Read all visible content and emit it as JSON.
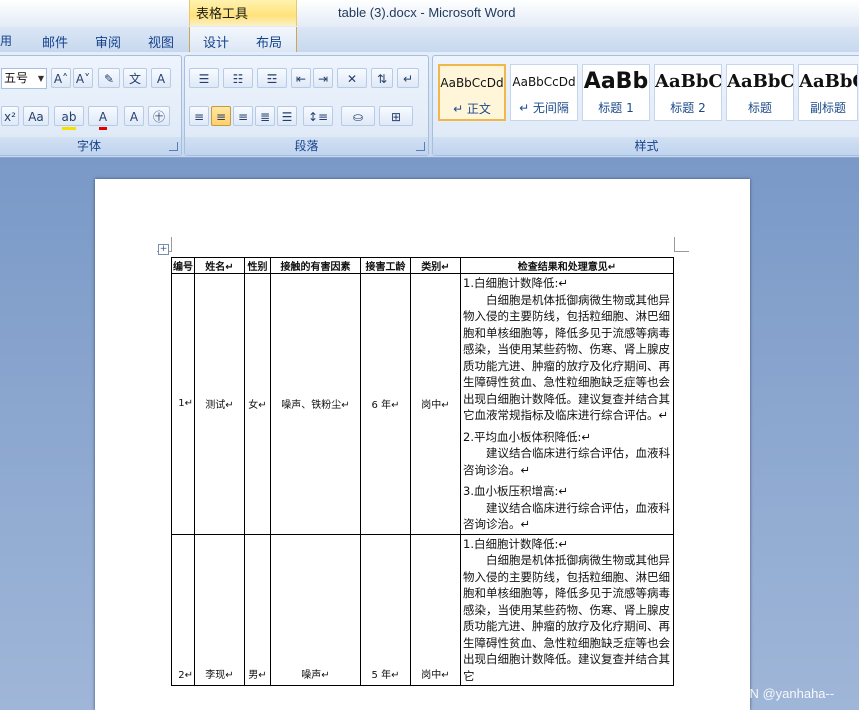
{
  "window": {
    "title": "table (3).docx - Microsoft Word",
    "context_tab": "表格工具"
  },
  "menu": {
    "tabs": [
      "用",
      "邮件",
      "审阅",
      "视图",
      "设计",
      "布局"
    ]
  },
  "ribbon": {
    "font_group": {
      "label": "字体",
      "font_size": "五号"
    },
    "paragraph_group": {
      "label": "段落"
    },
    "styles_group": {
      "label": "样式",
      "items": [
        {
          "sample": "AaBbCcDd",
          "name": "↵ 正文",
          "selected": true
        },
        {
          "sample": "AaBbCcDd",
          "name": "↵ 无间隔",
          "selected": false
        },
        {
          "sample": "AaBb",
          "name": "标题 1",
          "selected": false
        },
        {
          "sample": "AaBbC",
          "name": "标题 2",
          "selected": false
        },
        {
          "sample": "AaBbC",
          "name": "标题",
          "selected": false
        },
        {
          "sample": "AaBbC",
          "name": "副标题",
          "selected": false
        }
      ]
    }
  },
  "document": {
    "table": {
      "headers": [
        "编号",
        "姓名↵",
        "性别",
        "接触的有害因素",
        "接害工龄",
        "类别↵",
        "检查结果和处理意见↵"
      ],
      "rows": [
        {
          "id": "1↵",
          "name": "测试↵",
          "gender": "女↵",
          "hazard": "噪声、铁粉尘↵",
          "years": "6 年↵",
          "category": "岗中↵",
          "result": [
            {
              "title": "1.白细胞计数降低:↵",
              "body": "白细胞是机体抵御病微生物或其他异物入侵的主要防线，包括粒细胞、淋巴细胞和单核细胞等，降低多见于流感等病毒感染，当使用某些药物、伤寒、肾上腺皮质功能亢进、肿瘤的放疗及化疗期间、再生障碍性贫血、急性粒细胞缺乏症等也会出现白细胞计数降低。建议复查并结合其它血液常规指标及临床进行综合评估。↵"
            },
            {
              "title": "2.平均血小板体积降低:↵",
              "body": "建议结合临床进行综合评估，血液科咨询诊治。↵"
            },
            {
              "title": "3.血小板压积增高:↵",
              "body": "建议结合临床进行综合评估，血液科咨询诊治。↵"
            }
          ]
        },
        {
          "id": "2↵",
          "name": "李现↵",
          "gender": "男↵",
          "hazard": "噪声↵",
          "years": "5 年↵",
          "category": "岗中↵",
          "result": [
            {
              "title": "1.白细胞计数降低:↵",
              "body": "白细胞是机体抵御病微生物或其他异物入侵的主要防线，包括粒细胞、淋巴细胞和单核细胞等，降低多见于流感等病毒感染，当使用某些药物、伤寒、肾上腺皮质功能亢进、肿瘤的放疗及化疗期间、再生障碍性贫血、急性粒细胞缺乏症等也会出现白细胞计数降低。建议复查并结合其它"
            }
          ]
        }
      ]
    }
  },
  "watermark": "CSDN @yanhaha--"
}
